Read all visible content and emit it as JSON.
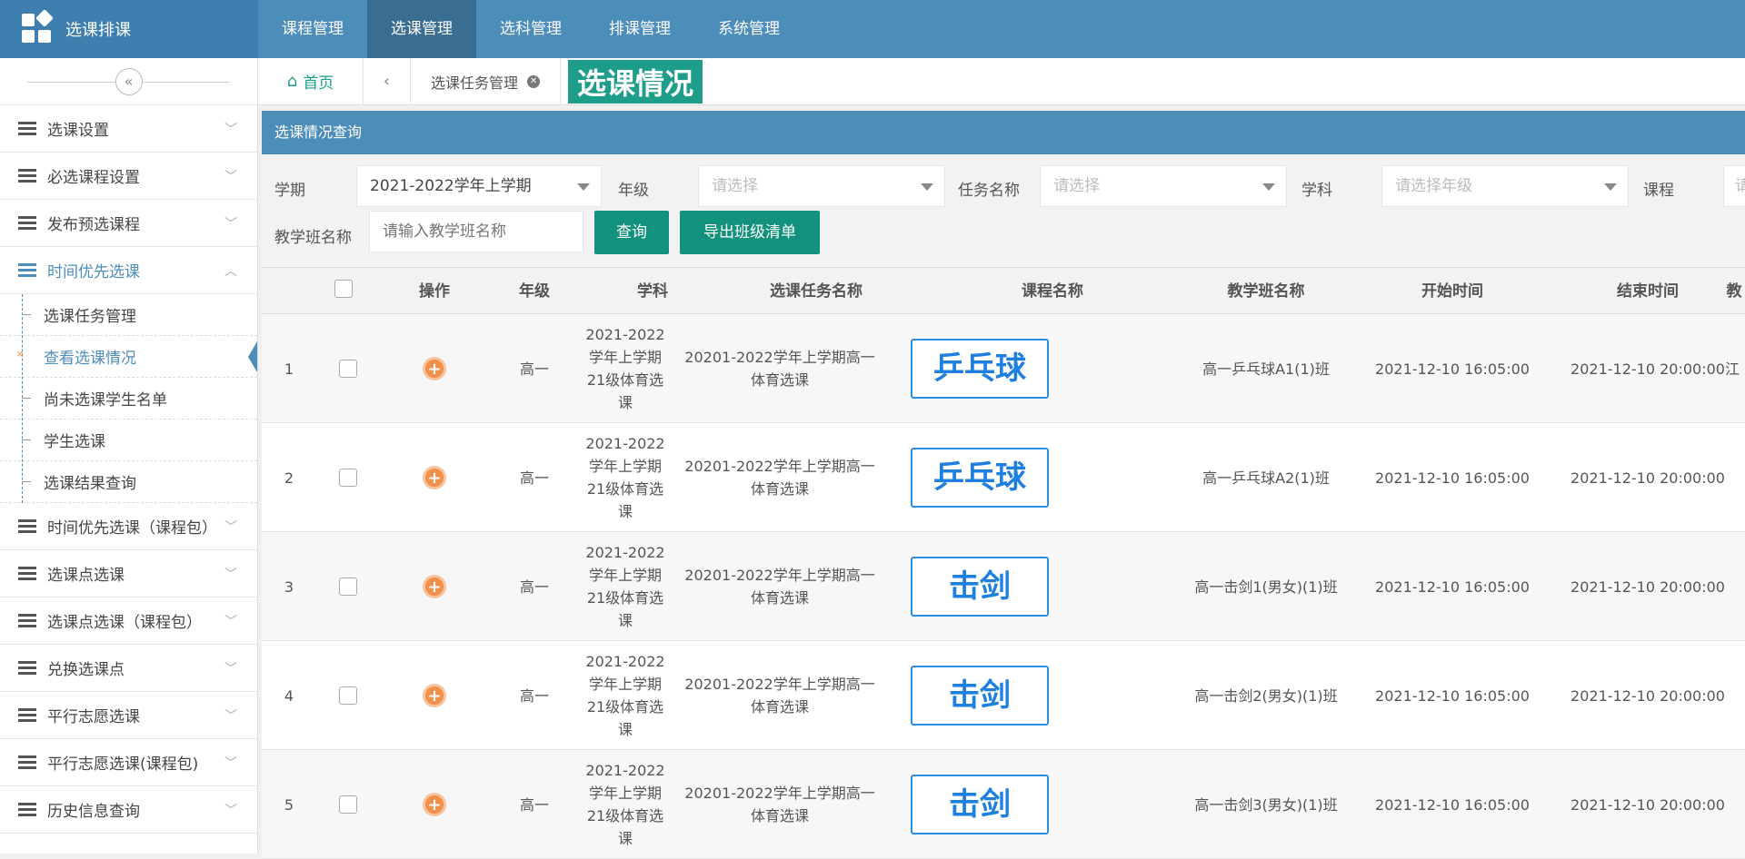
{
  "app": {
    "title": "选课排课"
  },
  "nav": {
    "items": [
      "课程管理",
      "选课管理",
      "选科管理",
      "排课管理",
      "系统管理"
    ],
    "active_index": 1
  },
  "sidebar": {
    "menu": [
      {
        "label": "选课设置"
      },
      {
        "label": "必选课程设置"
      },
      {
        "label": "发布预选课程"
      },
      {
        "label": "时间优先选课"
      }
    ],
    "submenu": [
      {
        "label": "选课任务管理"
      },
      {
        "label": "查看选课情况"
      },
      {
        "label": "尚未选课学生名单"
      },
      {
        "label": "学生选课"
      },
      {
        "label": "选课结果查询"
      }
    ],
    "menu_after": [
      {
        "label": "时间优先选课（课程包）"
      },
      {
        "label": "选课点选课"
      },
      {
        "label": "选课点选课（课程包）"
      },
      {
        "label": "兑换选课点"
      },
      {
        "label": "平行志愿选课"
      },
      {
        "label": "平行志愿选课(课程包)"
      },
      {
        "label": "历史信息查询"
      }
    ]
  },
  "tabs": {
    "home": "首页",
    "task": "选课任务管理",
    "current": "选课情况"
  },
  "panel": {
    "title": "选课情况查询"
  },
  "filters": {
    "term_label": "学期",
    "term_value": "2021-2022学年上学期",
    "grade_label": "年级",
    "grade_placeholder": "请选择",
    "task_label": "任务名称",
    "task_placeholder": "请选择",
    "subject_label": "学科",
    "subject_placeholder": "请选择年级",
    "course_label": "课程",
    "course_placeholder": "请",
    "class_label": "教学班名称",
    "class_placeholder": "请输入教学班名称",
    "query_button": "查询",
    "export_button": "导出班级清单"
  },
  "table": {
    "headers": [
      "操作",
      "年级",
      "学科",
      "选课任务名称",
      "课程名称",
      "教学班名称",
      "开始时间",
      "结束时间",
      "教"
    ],
    "rows": [
      {
        "no": "1",
        "grade": "高一",
        "subject": "2021-2022学年上学期21级体育选课",
        "task": "20201-2022学年上学期高一体育选课",
        "course": "乒乓球",
        "class": "高一乒乓球A1(1)班",
        "start": "2021-12-10 16:05:00",
        "end": "2021-12-10 20:00:00",
        "teacher": "江"
      },
      {
        "no": "2",
        "grade": "高一",
        "subject": "2021-2022学年上学期21级体育选课",
        "task": "20201-2022学年上学期高一体育选课",
        "course": "乒乓球",
        "class": "高一乒乓球A2(1)班",
        "start": "2021-12-10 16:05:00",
        "end": "2021-12-10 20:00:00",
        "teacher": ""
      },
      {
        "no": "3",
        "grade": "高一",
        "subject": "2021-2022学年上学期21级体育选课",
        "task": "20201-2022学年上学期高一体育选课",
        "course": "击剑",
        "class": "高一击剑1(男女)(1)班",
        "start": "2021-12-10 16:05:00",
        "end": "2021-12-10 20:00:00",
        "teacher": ""
      },
      {
        "no": "4",
        "grade": "高一",
        "subject": "2021-2022学年上学期21级体育选课",
        "task": "20201-2022学年上学期高一体育选课",
        "course": "击剑",
        "class": "高一击剑2(男女)(1)班",
        "start": "2021-12-10 16:05:00",
        "end": "2021-12-10 20:00:00",
        "teacher": ""
      },
      {
        "no": "5",
        "grade": "高一",
        "subject": "2021-2022学年上学期21级体育选课",
        "task": "20201-2022学年上学期高一体育选课",
        "course": "击剑",
        "class": "高一击剑3(男女)(1)班",
        "start": "2021-12-10 16:05:00",
        "end": "2021-12-10 20:00:00",
        "teacher": ""
      }
    ]
  },
  "colors": {
    "header": "#4d8dba",
    "accent_green": "#12917d",
    "course_blue": "#1d7fe0",
    "op_orange": "#f0904a"
  }
}
